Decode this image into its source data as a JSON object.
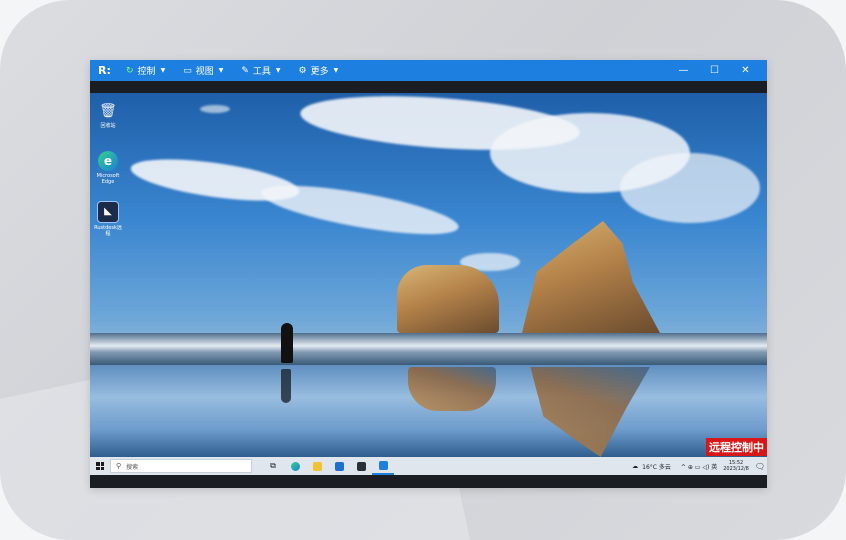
{
  "titlebar": {
    "logo": "R:",
    "menu": [
      {
        "icon": "↻",
        "label": "控制",
        "color": "#7dff7a"
      },
      {
        "icon": "▭",
        "label": "视图",
        "color": "#ffffff"
      },
      {
        "icon": "✎",
        "label": "工具",
        "color": "#ffffff"
      },
      {
        "icon": "⚙",
        "label": "更多",
        "color": "#ffffff"
      }
    ],
    "controls": {
      "minimize": "—",
      "maximize": "☐",
      "close": "✕"
    }
  },
  "desktop_icons": [
    {
      "label": "回收站",
      "glyph": "🗑"
    },
    {
      "label": "Microsoft Edge",
      "glyph": "e"
    },
    {
      "label": "Rustdesk远程",
      "glyph": "◣"
    }
  ],
  "badge": "远程控制中",
  "taskbar": {
    "search_placeholder": "搜索",
    "apps": [
      "task-view",
      "edge",
      "file-explorer",
      "mail",
      "store",
      "remote-app"
    ],
    "weather": "16°C 多云",
    "tray_icons": "^ ⊕ ▭ ◁) 英",
    "time": "15:52",
    "date": "2023/12/8"
  },
  "colors": {
    "titlebar": "#1d7fe0",
    "badge": "#d81818",
    "taskbar": "#dfe6ee"
  }
}
